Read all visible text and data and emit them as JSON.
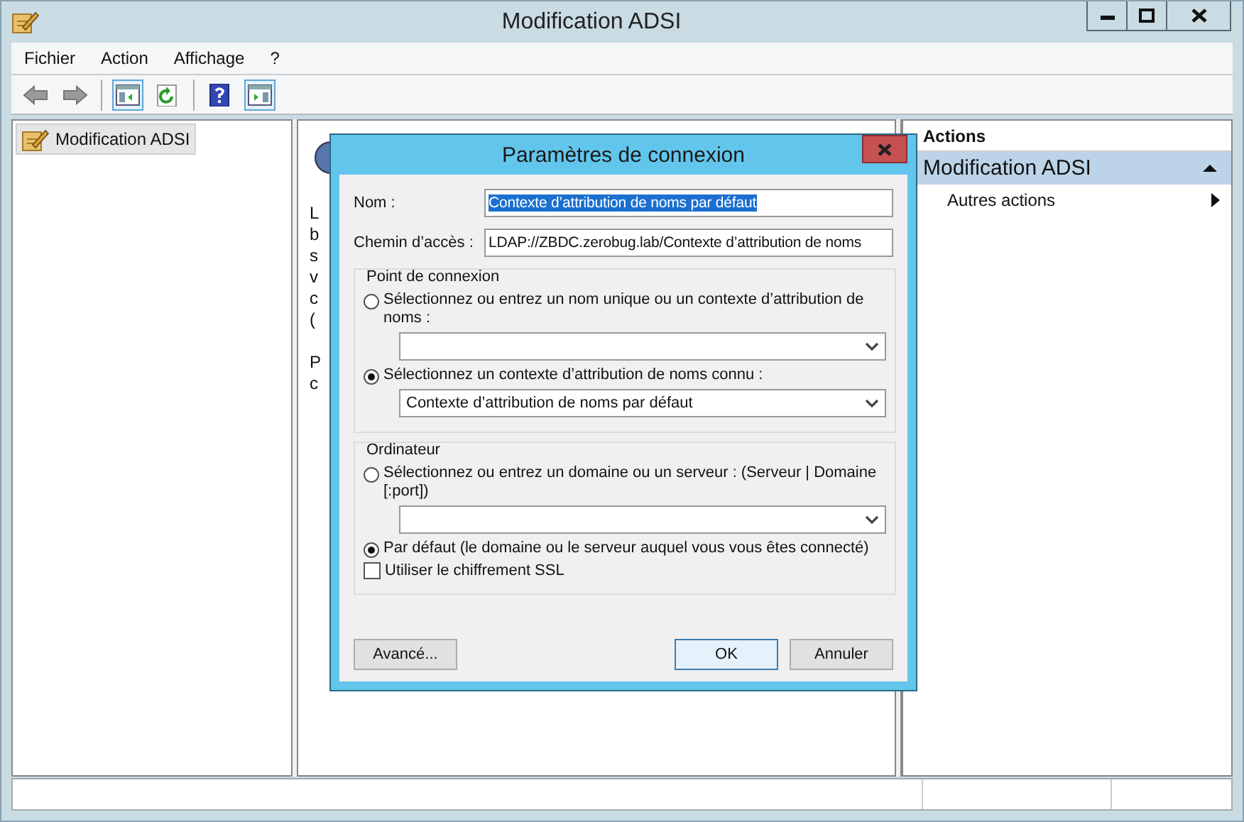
{
  "window": {
    "title": "Modification ADSI"
  },
  "menu": [
    "Fichier",
    "Action",
    "Affichage",
    "?"
  ],
  "toolbar": [
    [
      {
        "kind": "back",
        "pressed": false
      },
      {
        "kind": "forward",
        "pressed": false
      }
    ],
    [
      {
        "kind": "tree-pane",
        "pressed": true
      },
      {
        "kind": "refresh",
        "pressed": false
      }
    ],
    [
      {
        "kind": "help",
        "pressed": false
      },
      {
        "kind": "action-pane",
        "pressed": true
      }
    ]
  ],
  "tree": [
    {
      "label": "Modification ADSI",
      "selected": true
    }
  ],
  "center_pane": {
    "text_fragments": [
      "L",
      "b",
      "s",
      "v",
      "c",
      "(",
      "P",
      "c"
    ]
  },
  "actions_pane": {
    "title": "Actions",
    "section": {
      "label": "Modification ADSI",
      "expanded": true
    },
    "items": [
      {
        "label": "Autres actions"
      }
    ]
  },
  "dialog": {
    "title": "Paramètres de connexion",
    "fields": [
      {
        "label": "Nom :",
        "value": "Contexte d’attribution de noms par défaut",
        "highlighted": true
      },
      {
        "label": "Chemin d’accès :",
        "value": "LDAP://ZBDC.zerobug.lab/Contexte d’attribution de noms",
        "highlighted": false
      }
    ],
    "groups": [
      {
        "title": "Point de connexion",
        "rows": [
          {
            "kind": "radio",
            "label": "Sélectionnez ou entrez un nom unique ou un contexte d’attribution de noms :",
            "selected": false
          },
          {
            "kind": "combo"
          },
          {
            "kind": "radio",
            "label": "Sélectionnez un contexte d’attribution de noms connu :",
            "selected": true
          },
          {
            "kind": "combo",
            "value": "Contexte d’attribution de noms par défaut"
          }
        ]
      },
      {
        "title": "Ordinateur",
        "rows": [
          {
            "kind": "radio",
            "label": "Sélectionnez ou entrez un domaine ou un serveur : (Serveur | Domaine [:port])",
            "selected": false
          },
          {
            "kind": "combo"
          },
          {
            "kind": "radio",
            "label": "Par défaut (le domaine ou le serveur auquel vous vous êtes connecté)",
            "selected": true
          },
          {
            "kind": "checkbox",
            "label": "Utiliser le chiffrement SSL",
            "checked": false
          }
        ]
      }
    ],
    "buttons": [
      {
        "label": "Avancé...",
        "default": false
      },
      {
        "label": "OK",
        "default": true
      },
      {
        "label": "Annuler",
        "default": false
      }
    ]
  }
}
